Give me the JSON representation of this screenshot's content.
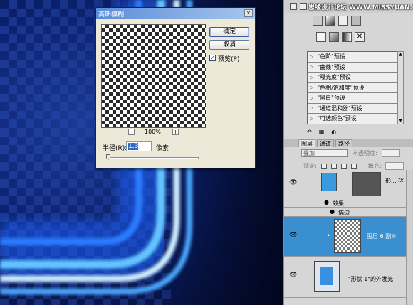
{
  "watermark": "思缘设计论坛 WWW.MISSYUAN.COM",
  "dialog": {
    "title": "高斯模糊",
    "ok_label": "确定",
    "cancel_label": "取消",
    "preview_label": "预览(P)",
    "preview_checked": true,
    "zoom_out": "-",
    "zoom_in": "+",
    "zoom_level": "100%",
    "radius_label": "半径(R):",
    "radius_value": "1.3",
    "radius_unit": "像素"
  },
  "presets": [
    {
      "label": "\"色阶\"预设"
    },
    {
      "label": "\"曲线\"预设"
    },
    {
      "label": "\"曝光度\"预设"
    },
    {
      "label": "\"色相/饱和度\"预设"
    },
    {
      "label": "\"黑白\"预设"
    },
    {
      "label": "\"通道混和器\"预设"
    },
    {
      "label": "\"可选颜色\"预设"
    }
  ],
  "layers_panel": {
    "tabs": [
      "图层",
      "通道",
      "路径"
    ],
    "active_tab": "图层",
    "blend_mode": "叠加",
    "opacity_label": "不透明度:",
    "opacity_value": "",
    "lock_label": "锁定:",
    "fill_label": "填充:",
    "fill_value": "",
    "layers": [
      {
        "name": "形...",
        "fx": "fx",
        "selected": false
      },
      {
        "name": "效果",
        "type": "effects-header"
      },
      {
        "name": "描边",
        "type": "effect"
      },
      {
        "name": "图层 6 副本",
        "selected": true
      },
      {
        "name": "\"形状 1\"的外发光",
        "selected": false
      }
    ]
  },
  "colors": {
    "selected_layer": "#3a8fd0",
    "dialog_bg": "#ece9d8",
    "titlebar": "#5a8cd8",
    "canvas_glow": "#5fb6ff"
  }
}
